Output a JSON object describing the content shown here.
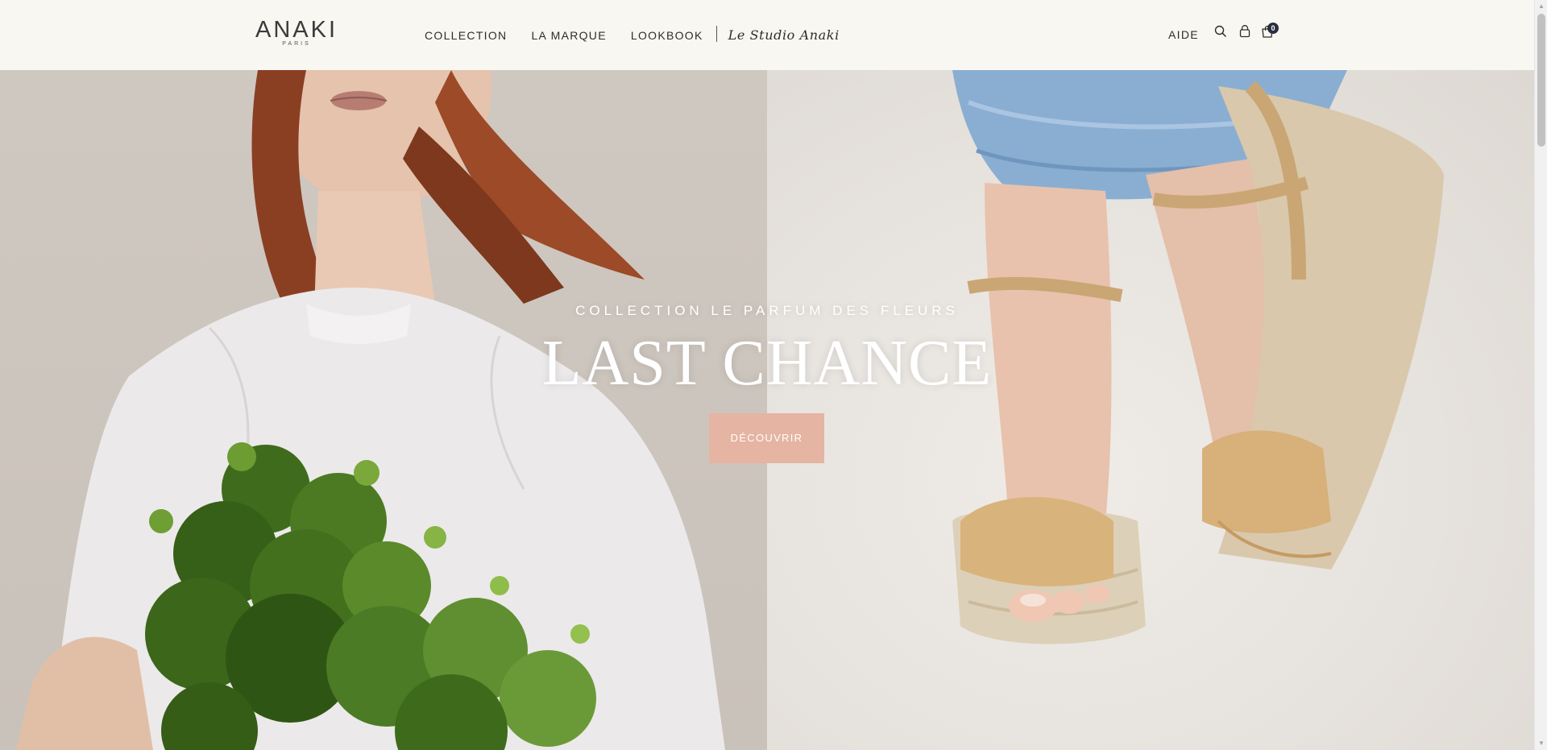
{
  "header": {
    "logo": "ANAKI",
    "logo_sub": "PARIS",
    "nav": [
      {
        "label": "COLLECTION"
      },
      {
        "label": "LA MARQUE"
      },
      {
        "label": "LOOKBOOK"
      }
    ],
    "studio_label": "Le Studio Anaki",
    "help_label": "AIDE",
    "cart_count": "0",
    "icons": [
      "search-icon",
      "account-icon",
      "bag-icon"
    ]
  },
  "hero": {
    "kicker": "COLLECTION LE PARFUM DES FLEURS",
    "title": "LAST CHANCE",
    "cta_label": "DÉCOUVRIR",
    "cta_color": "#e6b4a2"
  },
  "colors": {
    "header_bg": "#f9f7f2",
    "text": "#2d2d2d",
    "badge": "#2a2f3f"
  }
}
